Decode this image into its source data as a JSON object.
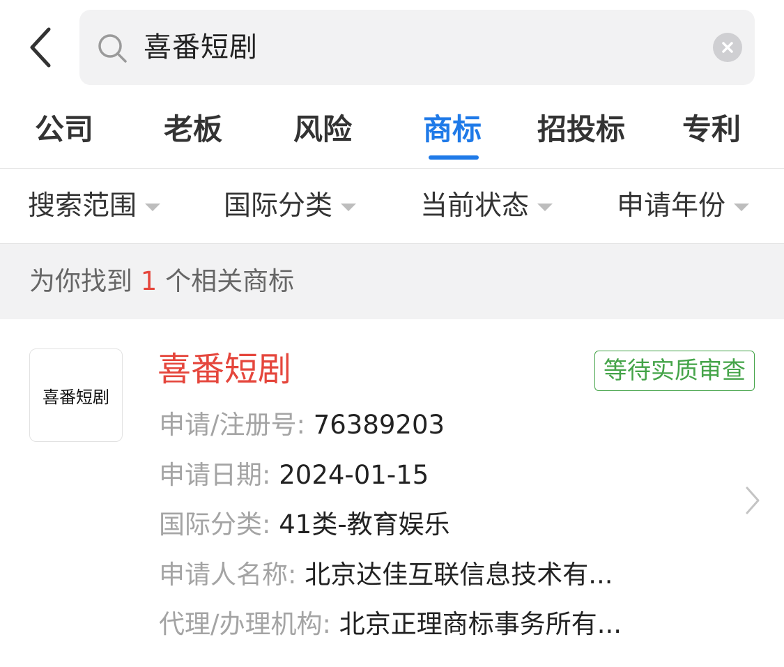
{
  "search": {
    "query": "喜番短剧"
  },
  "tabs": [
    {
      "label": "公司",
      "active": false
    },
    {
      "label": "老板",
      "active": false
    },
    {
      "label": "风险",
      "active": false
    },
    {
      "label": "商标",
      "active": true
    },
    {
      "label": "招投标",
      "active": false
    },
    {
      "label": "专利",
      "active": false
    }
  ],
  "filters": [
    {
      "label": "搜索范围"
    },
    {
      "label": "国际分类"
    },
    {
      "label": "当前状态"
    },
    {
      "label": "申请年份"
    }
  ],
  "result": {
    "prefix": "为你找到 ",
    "count": "1",
    "suffix": " 个相关商标"
  },
  "trademark": {
    "thumbnail_text": "喜番短剧",
    "name": "喜番短剧",
    "status": "等待实质审查",
    "fields": [
      {
        "label": "申请/注册号: ",
        "value": "76389203"
      },
      {
        "label": "申请日期: ",
        "value": "2024-01-15"
      },
      {
        "label": "国际分类: ",
        "value": "41类-教育娱乐"
      },
      {
        "label": "申请人名称: ",
        "value": "北京达佳互联信息技术有..."
      },
      {
        "label": "代理/办理机构: ",
        "value": "北京正理商标事务所有..."
      }
    ]
  },
  "colors": {
    "accent": "#1f7ae8",
    "highlight_red": "#e5463c",
    "status_green": "#45a449",
    "label_gray": "#a4a4a4",
    "strip_bg": "#f2f2f3"
  },
  "icons": {
    "back": "chevron-left-icon",
    "search": "search-icon",
    "clear": "close-circle-icon",
    "filter_caret": "caret-down-icon",
    "card_arrow": "chevron-right-icon"
  }
}
